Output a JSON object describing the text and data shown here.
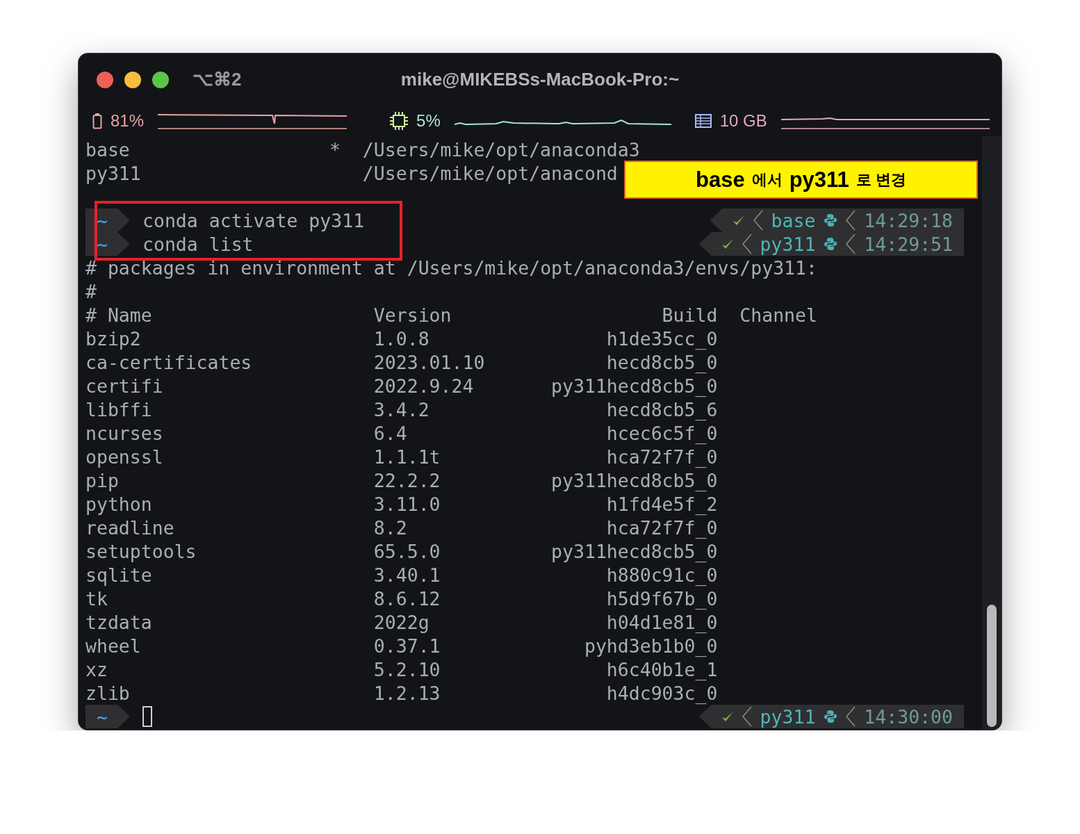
{
  "window": {
    "title": "mike@MIKEBSs-MacBook-Pro:~",
    "shortcut": "⌥⌘2"
  },
  "stats": [
    {
      "kind": "battery",
      "value": "81%",
      "color": "#e8a3a3"
    },
    {
      "kind": "cpu",
      "value": "5%",
      "color": "#a6e6d0"
    },
    {
      "kind": "memory",
      "value": "10 GB",
      "color": "#e3a6c8"
    }
  ],
  "active_marker": "*",
  "environments": [
    {
      "name": "base",
      "active": true,
      "path": "/Users/mike/opt/anaconda3"
    },
    {
      "name": "py311",
      "active": false,
      "path": "/Users/mike/opt/anacond"
    }
  ],
  "prompts": [
    {
      "dir": "~",
      "command": "conda activate py311",
      "success": true,
      "env": "base",
      "time": "14:29:18"
    },
    {
      "dir": "~",
      "command": "conda list",
      "success": true,
      "env": "py311",
      "time": "14:29:51"
    }
  ],
  "output_lines": [
    "# packages in environment at /Users/mike/opt/anaconda3/envs/py311:",
    "#"
  ],
  "columns": [
    "# Name",
    "Version",
    "Build",
    "Channel"
  ],
  "packages": [
    {
      "name": "bzip2",
      "version": "1.0.8",
      "build": "h1de35cc_0"
    },
    {
      "name": "ca-certificates",
      "version": "2023.01.10",
      "build": "hecd8cb5_0"
    },
    {
      "name": "certifi",
      "version": "2022.9.24",
      "build": "py311hecd8cb5_0"
    },
    {
      "name": "libffi",
      "version": "3.4.2",
      "build": "hecd8cb5_6"
    },
    {
      "name": "ncurses",
      "version": "6.4",
      "build": "hcec6c5f_0"
    },
    {
      "name": "openssl",
      "version": "1.1.1t",
      "build": "hca72f7f_0"
    },
    {
      "name": "pip",
      "version": "22.2.2",
      "build": "py311hecd8cb5_0"
    },
    {
      "name": "python",
      "version": "3.11.0",
      "build": "h1fd4e5f_2"
    },
    {
      "name": "readline",
      "version": "8.2",
      "build": "hca72f7f_0"
    },
    {
      "name": "setuptools",
      "version": "65.5.0",
      "build": "py311hecd8cb5_0"
    },
    {
      "name": "sqlite",
      "version": "3.40.1",
      "build": "h880c91c_0"
    },
    {
      "name": "tk",
      "version": "8.6.12",
      "build": "h5d9f67b_0"
    },
    {
      "name": "tzdata",
      "version": "2022g",
      "build": "h04d1e81_0"
    },
    {
      "name": "wheel",
      "version": "0.37.1",
      "build": "pyhd3eb1b0_0"
    },
    {
      "name": "xz",
      "version": "5.2.10",
      "build": "h6c40b1e_1"
    },
    {
      "name": "zlib",
      "version": "1.2.13",
      "build": "h4dc903c_0"
    }
  ],
  "final_prompt": {
    "dir": "~",
    "success": true,
    "env": "py311",
    "time": "14:30:00"
  },
  "callout": [
    {
      "text": "base",
      "strong": true
    },
    {
      "text": "에서",
      "strong": false
    },
    {
      "text": "py311",
      "strong": true
    },
    {
      "text": "로 변경",
      "strong": false
    }
  ]
}
